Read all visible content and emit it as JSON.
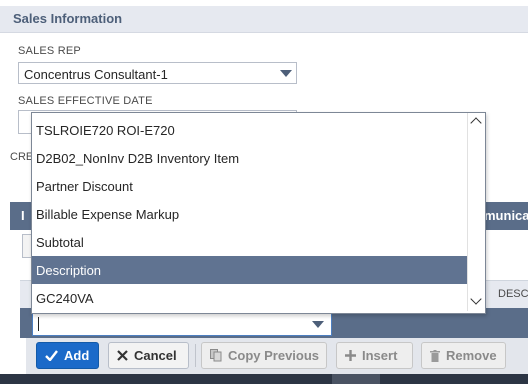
{
  "section": {
    "title": "Sales Information"
  },
  "sales_rep": {
    "label": "SALES REP",
    "value": "Concentrus Consultant-1"
  },
  "sales_effective_date": {
    "label": "SALES EFFECTIVE DATE"
  },
  "truncated": {
    "cre": "CRE",
    "tab_left": "I",
    "tab_right": "munica",
    "grid_col": "DESC"
  },
  "dropdown": {
    "options": [
      "TSLROIE720 ROI-E720",
      "D2B02_NonInv D2B Inventory Item",
      "Partner Discount",
      "Billable Expense Markup",
      "Subtotal",
      "Description",
      "GC240VA"
    ],
    "selected_index": 5
  },
  "buttons": {
    "add": "Add",
    "cancel": "Cancel",
    "copy_previous": "Copy Previous",
    "insert": "Insert",
    "remove": "Remove"
  },
  "colors": {
    "header_bg": "#e6e9f0",
    "accent_blue": "#1b6ac9",
    "row_selected": "#607391",
    "tab_bar": "#5a6d89"
  }
}
